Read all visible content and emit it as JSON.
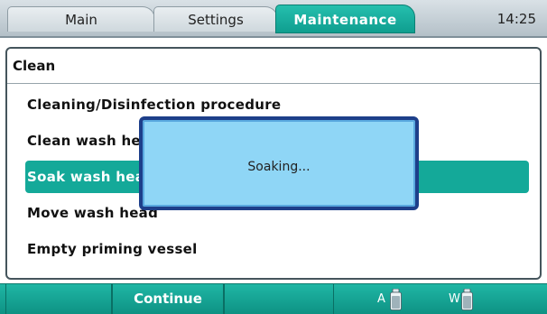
{
  "tabs": [
    {
      "label": "Main"
    },
    {
      "label": "Settings"
    },
    {
      "label": "Maintenance",
      "active": true
    }
  ],
  "clock": "14:25",
  "panel": {
    "title": "Clean",
    "items": [
      {
        "label": "Cleaning/Disinfection procedure"
      },
      {
        "label": "Clean wash head"
      },
      {
        "label": "Soak wash head",
        "selected": true
      },
      {
        "label": "Move wash head"
      },
      {
        "label": "Empty priming vessel"
      }
    ]
  },
  "dialog": {
    "message": "Soaking..."
  },
  "softkeys": [
    "",
    "Continue",
    ""
  ],
  "bottles": [
    {
      "label": "A",
      "icon": "bottle-icon"
    },
    {
      "label": "W",
      "icon": "bottle-icon"
    }
  ],
  "colors": {
    "accent": "#14a999",
    "dialog_bg": "#8fd6f6",
    "dialog_border": "#1d3f8a"
  }
}
